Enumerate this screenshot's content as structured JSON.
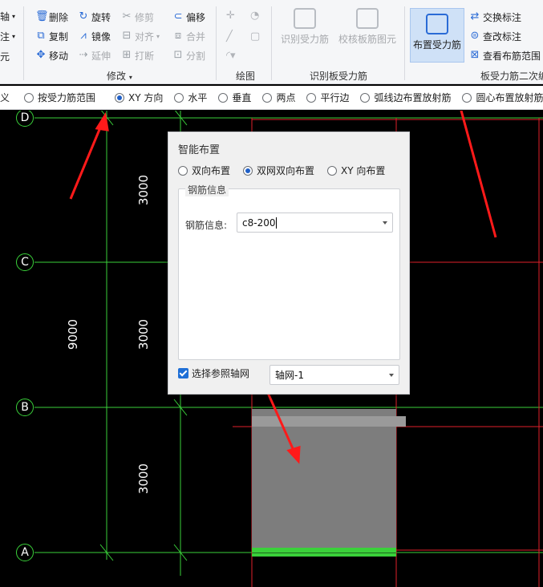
{
  "ribbon": {
    "left_cut": [
      {
        "label": "轴",
        "has_caret": true
      },
      {
        "label": "注",
        "has_caret": true
      },
      {
        "label": "元",
        "has_caret": false
      }
    ],
    "modify": {
      "col1": [
        "删除",
        "复制",
        "移动"
      ],
      "col2": [
        "旋转",
        "镜像",
        "延伸"
      ],
      "col3": [
        "修剪",
        "对齐",
        "打断"
      ],
      "col4": [
        "偏移",
        "合并",
        "分割"
      ],
      "group_label": "修改"
    },
    "draw": {
      "group_label": "绘图"
    },
    "identify": {
      "btn1": "识别受力筋",
      "btn2": "校核板筋图元",
      "group_label": "识别板受力筋"
    },
    "place": {
      "active_btn": "布置受力筋",
      "small1": "交换标注",
      "small2": "查改标注",
      "small3": "查看布筋范围",
      "group_label": "板受力筋二次编"
    }
  },
  "optbar": {
    "cut_label": "义",
    "options": [
      "按受力筋范围",
      "XY 方向",
      "水平",
      "垂直",
      "两点",
      "平行边",
      "弧线边布置放射筋",
      "圆心布置放射筋"
    ],
    "selected_index": 1
  },
  "canvas": {
    "axes": [
      "D",
      "C",
      "B",
      "A"
    ],
    "dims": {
      "top": "3000",
      "mid": "3000",
      "bottom": "3000",
      "total": "9000"
    }
  },
  "dialog": {
    "title": "智能布置",
    "modes": [
      "双向布置",
      "双网双向布置",
      "XY 向布置"
    ],
    "selected_mode": 1,
    "group_legend": "钢筋信息",
    "rebar_label": "钢筋信息:",
    "rebar_value": "c8-200",
    "checkbox_label": "选择参照轴网",
    "checkbox_checked": true,
    "axis_value": "轴网-1"
  },
  "colors": {
    "grid_green": "#3ad13a",
    "slab_red": "#e0202a",
    "annotation_red": "#ff1a1a",
    "accent_blue": "#1f5fc7"
  }
}
